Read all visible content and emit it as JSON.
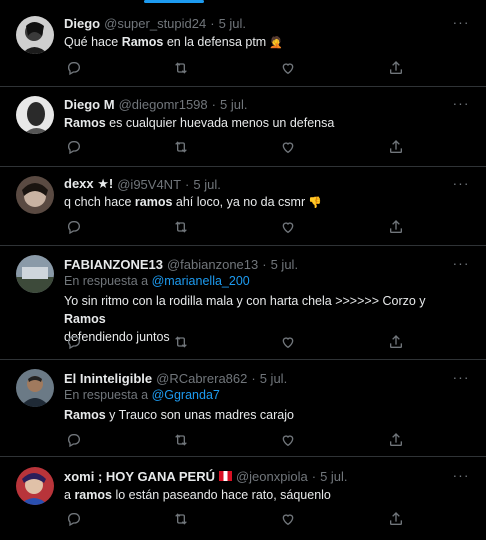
{
  "tweets": [
    {
      "name": "Diego",
      "handle": "@super_stupid24",
      "date": "5 jul.",
      "avatar": "avatar-diego-icon",
      "text": [
        "Qué hace ",
        "Ramos",
        " en la defensa ptm"
      ],
      "emoji": "🤦"
    },
    {
      "name": "Diego M",
      "handle": "@diegomr1598",
      "date": "5 jul.",
      "avatar": "avatar-diego-m-icon",
      "text": [
        "",
        "Ramos",
        " es cualquier huevada menos un defensa"
      ]
    },
    {
      "name": "dexx ★!",
      "handle": "@i95V4NT",
      "date": "5 jul.",
      "avatar": "avatar-dexx-icon",
      "text": [
        "q chch hace ",
        "ramos",
        " ahí loco, ya no da csmr"
      ],
      "emoji": "👎"
    },
    {
      "name": "FABIANZONE13",
      "handle": "@fabianzone13",
      "date": "5 jul.",
      "avatar": "avatar-fabianzone-icon",
      "reply_prefix": "En respuesta a ",
      "reply_to": "@marianella_200",
      "text_line1": "Yo sin ritmo con la rodilla mala y con harta chela >>>>>> Corzo y ",
      "text_bold": "Ramos",
      "text_line2": "defendiendo juntos"
    },
    {
      "name": "El Ininteligible",
      "handle": "@RCabrera862",
      "date": "5 jul.",
      "avatar": "avatar-ininteligible-icon",
      "reply_prefix": "En respuesta a ",
      "reply_to": "@Ggranda7",
      "text": [
        "",
        "Ramos",
        " y Trauco son unas madres carajo"
      ]
    },
    {
      "name": "xomi ; HOY GANA PERÚ",
      "handle": "@jeonxpiola",
      "date": "5 jul.",
      "avatar": "avatar-xomi-icon",
      "text": [
        "a ",
        "ramos",
        " lo están paseando hace rato, sáquenlo"
      ]
    }
  ],
  "sep": "·",
  "more_label": "···",
  "colors": {
    "accent": "#1d9bf0",
    "muted": "#71767b",
    "text": "#e7e9ea",
    "border": "#2f3336",
    "bg": "#000000"
  }
}
